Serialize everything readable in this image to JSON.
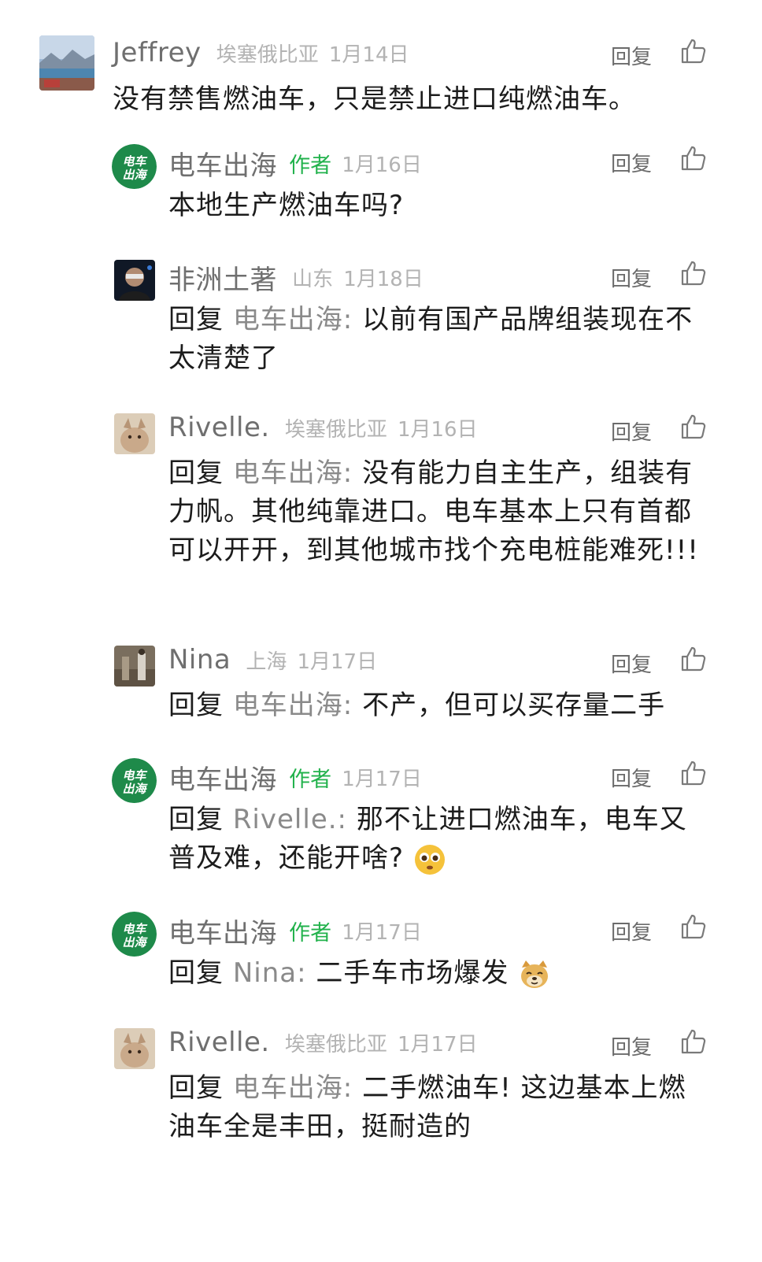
{
  "ui": {
    "reply_label": "回复",
    "reply_prefix": "回复",
    "author_tag": "作者"
  },
  "comments": [
    {
      "user": "Jeffrey",
      "location": "埃塞俄比亚",
      "date": "1月14日",
      "text": "没有禁售燃油车，只是禁止进口纯燃油车。"
    },
    {
      "user": "电车出海",
      "date": "1月16日",
      "text": "本地生产燃油车吗?"
    },
    {
      "user": "非洲土著",
      "location": "山东",
      "date": "1月18日",
      "reply_to": "电车出海:",
      "text": "以前有国产品牌组装现在不太清楚了"
    },
    {
      "user": "Rivelle.",
      "location": "埃塞俄比亚",
      "date": "1月16日",
      "reply_to": "电车出海:",
      "text": "没有能力自主生产，组装有力帆。其他纯靠进口。电车基本上只有首都可以开开，到其他城市找个充电桩能难死!!!"
    },
    {
      "user": "Nina",
      "location": "上海",
      "date": "1月17日",
      "reply_to": "电车出海:",
      "text": "不产，但可以买存量二手"
    },
    {
      "user": "电车出海",
      "date": "1月17日",
      "reply_to": "Rivelle.:",
      "text": "那不让进口燃油车，电车又普及难，还能开啥?",
      "emoji": "pleading-face-emoji"
    },
    {
      "user": "电车出海",
      "date": "1月17日",
      "reply_to": "Nina:",
      "text": "二手车市场爆发",
      "emoji": "doge-emoji"
    },
    {
      "user": "Rivelle.",
      "location": "埃塞俄比亚",
      "date": "1月17日",
      "reply_to": "电车出海:",
      "text": "二手燃油车! 这边基本上燃油车全是丰田，挺耐造的"
    }
  ],
  "colors": {
    "author_green": "#22b24c",
    "name_gray": "#6f6f6f",
    "meta_gray": "#b3b3b3",
    "avatar_brand_green": "#1e8a4a"
  },
  "icons": {
    "like": "thumbs-up-icon",
    "brand_avatar_text": "电车出海"
  }
}
